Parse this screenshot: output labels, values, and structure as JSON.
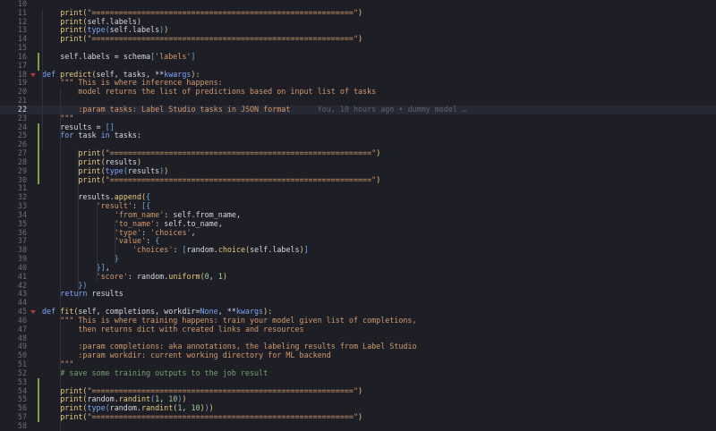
{
  "editor": {
    "current_line": 22,
    "blame": "You, 10 hours ago • dummy model …",
    "lines": [
      {
        "n": 10,
        "indent": 0,
        "t": []
      },
      {
        "n": 11,
        "indent": 2,
        "t": [
          [
            "fn",
            "print"
          ],
          [
            "par",
            "("
          ],
          [
            "str",
            "\"==========================================================\""
          ],
          [
            "par",
            ")"
          ]
        ]
      },
      {
        "n": 12,
        "indent": 2,
        "t": [
          [
            "fn",
            "print"
          ],
          [
            "par",
            "("
          ],
          [
            "",
            "self.labels"
          ],
          [
            "par",
            ")"
          ]
        ]
      },
      {
        "n": 13,
        "indent": 2,
        "t": [
          [
            "fn",
            "print"
          ],
          [
            "par",
            "("
          ],
          [
            "kw",
            "type"
          ],
          [
            "brk",
            "("
          ],
          [
            "",
            "self.labels"
          ],
          [
            "brk",
            ")"
          ],
          [
            "par",
            ")"
          ]
        ]
      },
      {
        "n": 14,
        "indent": 2,
        "t": [
          [
            "fn",
            "print"
          ],
          [
            "par",
            "("
          ],
          [
            "str",
            "\"==========================================================\""
          ],
          [
            "par",
            ")"
          ]
        ]
      },
      {
        "n": 15,
        "indent": 0,
        "t": []
      },
      {
        "n": 16,
        "indent": 2,
        "t": [
          [
            "",
            "self.labels = schema"
          ],
          [
            "brk",
            "["
          ],
          [
            "str",
            "'labels'"
          ],
          [
            "brk",
            "]"
          ]
        ]
      },
      {
        "n": 17,
        "indent": 0,
        "t": []
      },
      {
        "n": 18,
        "indent": 1,
        "t": [
          [
            "kw",
            "def "
          ],
          [
            "fn",
            "predict"
          ],
          [
            "par",
            "("
          ],
          [
            "",
            "self, tasks, **"
          ],
          [
            "kw",
            "kwargs"
          ],
          [
            "par",
            "):"
          ]
        ]
      },
      {
        "n": 19,
        "indent": 2,
        "t": [
          [
            "doc",
            "\"\"\" This is where inference happens:"
          ]
        ]
      },
      {
        "n": 20,
        "indent": 3,
        "t": [
          [
            "doc",
            "model returns the list of predictions based on input list of tasks"
          ]
        ]
      },
      {
        "n": 21,
        "indent": 0,
        "t": []
      },
      {
        "n": 22,
        "indent": 3,
        "t": [
          [
            "doc",
            ":param tasks: Label Studio tasks in JSON format"
          ]
        ]
      },
      {
        "n": 23,
        "indent": 2,
        "t": [
          [
            "doc",
            "\"\"\""
          ]
        ]
      },
      {
        "n": 24,
        "indent": 2,
        "t": [
          [
            "",
            "results = "
          ],
          [
            "brk",
            "[]"
          ]
        ]
      },
      {
        "n": 25,
        "indent": 2,
        "t": [
          [
            "kw",
            "for "
          ],
          [
            "",
            "task "
          ],
          [
            "kw",
            "in "
          ],
          [
            "",
            "tasks:"
          ]
        ]
      },
      {
        "n": 26,
        "indent": 0,
        "t": []
      },
      {
        "n": 27,
        "indent": 3,
        "t": [
          [
            "fn",
            "print"
          ],
          [
            "par",
            "("
          ],
          [
            "str",
            "\"==========================================================\""
          ],
          [
            "par",
            ")"
          ]
        ]
      },
      {
        "n": 28,
        "indent": 3,
        "t": [
          [
            "fn",
            "print"
          ],
          [
            "par",
            "("
          ],
          [
            "",
            "results"
          ],
          [
            "par",
            ")"
          ]
        ]
      },
      {
        "n": 29,
        "indent": 3,
        "t": [
          [
            "fn",
            "print"
          ],
          [
            "par",
            "("
          ],
          [
            "kw",
            "type"
          ],
          [
            "brk",
            "("
          ],
          [
            "",
            "results"
          ],
          [
            "brk",
            ")"
          ],
          [
            "par",
            ")"
          ]
        ]
      },
      {
        "n": 30,
        "indent": 3,
        "t": [
          [
            "fn",
            "print"
          ],
          [
            "par",
            "("
          ],
          [
            "str",
            "\"==========================================================\""
          ],
          [
            "par",
            ")"
          ]
        ]
      },
      {
        "n": 31,
        "indent": 0,
        "t": []
      },
      {
        "n": 32,
        "indent": 3,
        "t": [
          [
            "",
            "results."
          ],
          [
            "fn",
            "append"
          ],
          [
            "par",
            "("
          ],
          [
            "brk",
            "{"
          ]
        ]
      },
      {
        "n": 33,
        "indent": 4,
        "t": [
          [
            "str",
            "'result'"
          ],
          [
            "",
            ": "
          ],
          [
            "brk",
            "[{"
          ]
        ]
      },
      {
        "n": 34,
        "indent": 5,
        "t": [
          [
            "str",
            "'from_name'"
          ],
          [
            "",
            ": self.from_name,"
          ]
        ]
      },
      {
        "n": 35,
        "indent": 5,
        "t": [
          [
            "str",
            "'to_name'"
          ],
          [
            "",
            ": self.to_name,"
          ]
        ]
      },
      {
        "n": 36,
        "indent": 5,
        "t": [
          [
            "str",
            "'type'"
          ],
          [
            "",
            ": "
          ],
          [
            "str",
            "'choices'"
          ],
          [
            "",
            ","
          ]
        ]
      },
      {
        "n": 37,
        "indent": 5,
        "t": [
          [
            "str",
            "'value'"
          ],
          [
            "",
            ": "
          ],
          [
            "brk",
            "{"
          ]
        ]
      },
      {
        "n": 38,
        "indent": 6,
        "t": [
          [
            "str",
            "'choices'"
          ],
          [
            "",
            ": "
          ],
          [
            "brk",
            "["
          ],
          [
            "",
            "random."
          ],
          [
            "fn",
            "choice"
          ],
          [
            "par",
            "("
          ],
          [
            "",
            "self.labels"
          ],
          [
            "par",
            ")"
          ],
          [
            "brk",
            "]"
          ]
        ]
      },
      {
        "n": 39,
        "indent": 5,
        "t": [
          [
            "brk",
            "}"
          ]
        ]
      },
      {
        "n": 40,
        "indent": 4,
        "t": [
          [
            "brk",
            "}]"
          ],
          [
            "",
            ","
          ]
        ]
      },
      {
        "n": 41,
        "indent": 4,
        "t": [
          [
            "str",
            "'score'"
          ],
          [
            "",
            ": random."
          ],
          [
            "fn",
            "uniform"
          ],
          [
            "par",
            "("
          ],
          [
            "num",
            "0"
          ],
          [
            "",
            ", "
          ],
          [
            "num",
            "1"
          ],
          [
            "par",
            ")"
          ]
        ]
      },
      {
        "n": 42,
        "indent": 3,
        "t": [
          [
            "brk",
            "})"
          ]
        ]
      },
      {
        "n": 43,
        "indent": 2,
        "t": [
          [
            "kw",
            "return "
          ],
          [
            "",
            "results"
          ]
        ]
      },
      {
        "n": 44,
        "indent": 0,
        "t": []
      },
      {
        "n": 45,
        "indent": 1,
        "t": [
          [
            "kw",
            "def "
          ],
          [
            "fn",
            "fit"
          ],
          [
            "par",
            "("
          ],
          [
            "",
            "self, completions, workdir="
          ],
          [
            "kw",
            "None"
          ],
          [
            "",
            ", **"
          ],
          [
            "kw",
            "kwargs"
          ],
          [
            "par",
            "):"
          ]
        ]
      },
      {
        "n": 46,
        "indent": 2,
        "t": [
          [
            "doc",
            "\"\"\" This is where training happens: train your model given list of completions,"
          ]
        ]
      },
      {
        "n": 47,
        "indent": 3,
        "t": [
          [
            "doc",
            "then returns dict with created links and resources"
          ]
        ]
      },
      {
        "n": 48,
        "indent": 0,
        "t": []
      },
      {
        "n": 49,
        "indent": 3,
        "t": [
          [
            "doc",
            ":param completions: aka annotations, the labeling results from Label Studio"
          ]
        ]
      },
      {
        "n": 50,
        "indent": 3,
        "t": [
          [
            "doc",
            ":param workdir: current working directory for ML backend"
          ]
        ]
      },
      {
        "n": 51,
        "indent": 2,
        "t": [
          [
            "doc",
            "\"\"\""
          ]
        ]
      },
      {
        "n": 52,
        "indent": 2,
        "t": [
          [
            "com",
            "# save some training outputs to the job result"
          ]
        ]
      },
      {
        "n": 53,
        "indent": 0,
        "t": []
      },
      {
        "n": 54,
        "indent": 2,
        "t": [
          [
            "fn",
            "print"
          ],
          [
            "par",
            "("
          ],
          [
            "str",
            "\"==========================================================\""
          ],
          [
            "par",
            ")"
          ]
        ]
      },
      {
        "n": 55,
        "indent": 2,
        "t": [
          [
            "fn",
            "print"
          ],
          [
            "par",
            "("
          ],
          [
            "",
            "random."
          ],
          [
            "fn",
            "randint"
          ],
          [
            "brk",
            "("
          ],
          [
            "num",
            "1"
          ],
          [
            "",
            ", "
          ],
          [
            "num",
            "10"
          ],
          [
            "brk",
            ")"
          ],
          [
            "par",
            ")"
          ]
        ]
      },
      {
        "n": 56,
        "indent": 2,
        "t": [
          [
            "fn",
            "print"
          ],
          [
            "par",
            "("
          ],
          [
            "kw",
            "type"
          ],
          [
            "brk",
            "("
          ],
          [
            "",
            "random."
          ],
          [
            "fn",
            "randint"
          ],
          [
            "par",
            "("
          ],
          [
            "num",
            "1"
          ],
          [
            "",
            ", "
          ],
          [
            "num",
            "10"
          ],
          [
            "par",
            ")"
          ],
          [
            "brk",
            ")"
          ],
          [
            "par",
            ")"
          ]
        ]
      },
      {
        "n": 57,
        "indent": 2,
        "t": [
          [
            "fn",
            "print"
          ],
          [
            "par",
            "("
          ],
          [
            "str",
            "\"==========================================================\""
          ],
          [
            "par",
            ")"
          ]
        ]
      },
      {
        "n": 58,
        "indent": 0,
        "t": []
      }
    ]
  }
}
